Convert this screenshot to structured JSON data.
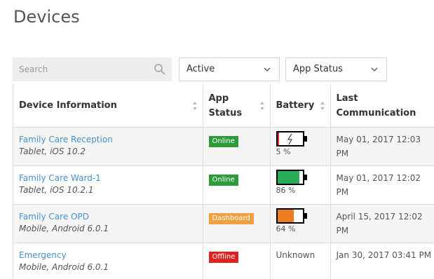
{
  "page": {
    "title": "Devices"
  },
  "filters": {
    "search_placeholder": "Search",
    "status_value": "Active",
    "app_status_value": "App Status"
  },
  "table": {
    "headers": {
      "device": "Device Information",
      "app_status_line1": "App",
      "app_status_line2": "Status",
      "battery": "Battery",
      "last_comm_line1": "Last",
      "last_comm_line2": "Communication"
    },
    "rows": [
      {
        "name": "Family Care Reception",
        "sub": "Tablet, iOS 10.2",
        "status": "Online",
        "status_color": "#2e9b3b",
        "battery_pct": "5 %",
        "battery_level": 0.05,
        "battery_color": "#d9302b",
        "charging": true,
        "last_line1": "May 01, 2017 12:03",
        "last_line2": "PM"
      },
      {
        "name": "Family Care Ward-1",
        "sub": "Tablet, iOS 10.2.1",
        "status": "Online",
        "status_color": "#2e9b3b",
        "battery_pct": "86 %",
        "battery_level": 0.86,
        "battery_color": "#2aad5b",
        "charging": false,
        "last_line1": "May 01, 2017 12:02",
        "last_line2": "PM"
      },
      {
        "name": "Family Care OPD",
        "sub": "Mobile, Android 6.0.1",
        "status": "Dashboard",
        "status_color": "#f0a042",
        "battery_pct": "64 %",
        "battery_level": 0.64,
        "battery_color": "#ed7d22",
        "charging": false,
        "last_line1": "April 15, 2017 12:02",
        "last_line2": "PM"
      },
      {
        "name": "Emergency",
        "sub": "Mobile, Android 6.0.1",
        "status": "Offline",
        "status_color": "#dd2222",
        "battery_text": "Unknown",
        "last_line1": "Jan 30, 2017 03:41 PM",
        "last_line2": ""
      }
    ]
  }
}
